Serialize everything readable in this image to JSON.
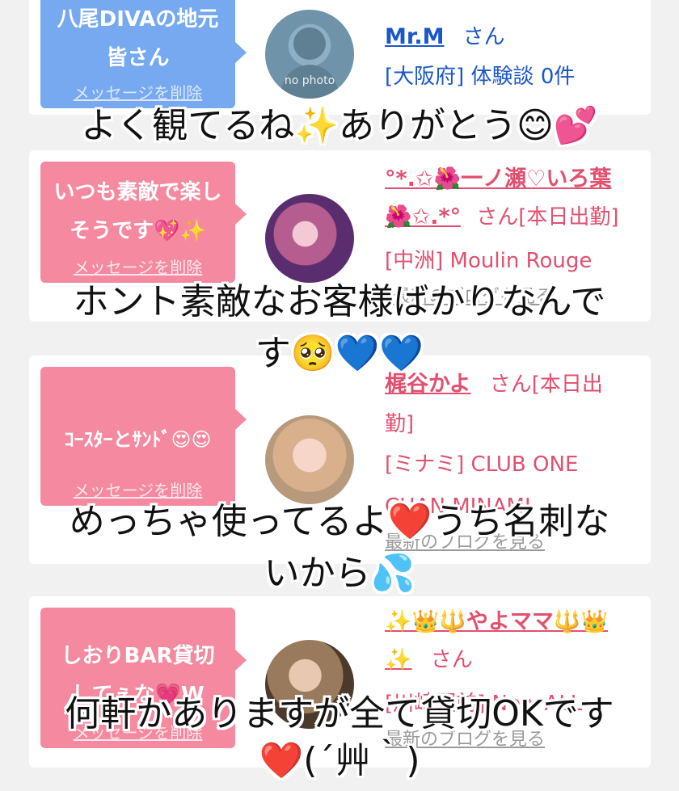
{
  "colors": {
    "blue_bubble": "#76a9ef",
    "pink_bubble": "#f4899f",
    "pink_text": "#e2506f",
    "blue_text": "#1b57c9"
  },
  "cards": [
    {
      "bubble_text": "八尾DIVAの地元\n皆さん",
      "delete_label": "メッセージを削除",
      "avatar_text": "no photo",
      "name": "Mr.M",
      "san": "さん",
      "detail": "[大阪府] 体験談 0件",
      "blog": ""
    },
    {
      "bubble_text": "いつも素敵で楽し\nそうです💖✨",
      "delete_label": "メッセージを削除",
      "name": "°*.✩🌺一ノ瀬♡いろ葉",
      "name2": "🌺✩.*°",
      "san": "さん[本日出勤]",
      "detail": "[中洲] Moulin Rouge",
      "blog": "最新のブログを見る"
    },
    {
      "bubble_text": "ｺｰｽﾀｰとｻﾝﾄﾞ😍😍",
      "delete_label": "メッセージを削除",
      "name": "梶谷かよ",
      "san": "さん[本日出",
      "san2": "勤]",
      "detail": "[ミナミ] CLUB ONE",
      "detail2": "CHAN MINAMI",
      "blog": "最新のブログを見る"
    },
    {
      "bubble_text": "しおりBAR貸切\nしてぇな💗W",
      "delete_label": "メッセージを削除",
      "name": "✨👑🔱やよママ🔱👑",
      "name2": "✨",
      "san": "さん",
      "detail": "[川崎駅前] New ALL",
      "blog": "最新のブログを見る"
    }
  ],
  "captions": [
    "よく観てるね✨ありがとう😊💕",
    "ホント素敵なお客様ばかりなんで",
    "す🥺💙💙",
    "めっちゃ使ってるよ❤️うち名刺な",
    "いから💦",
    "何軒かありますが全て貸切OKです",
    "❤️(´艸｀)"
  ]
}
